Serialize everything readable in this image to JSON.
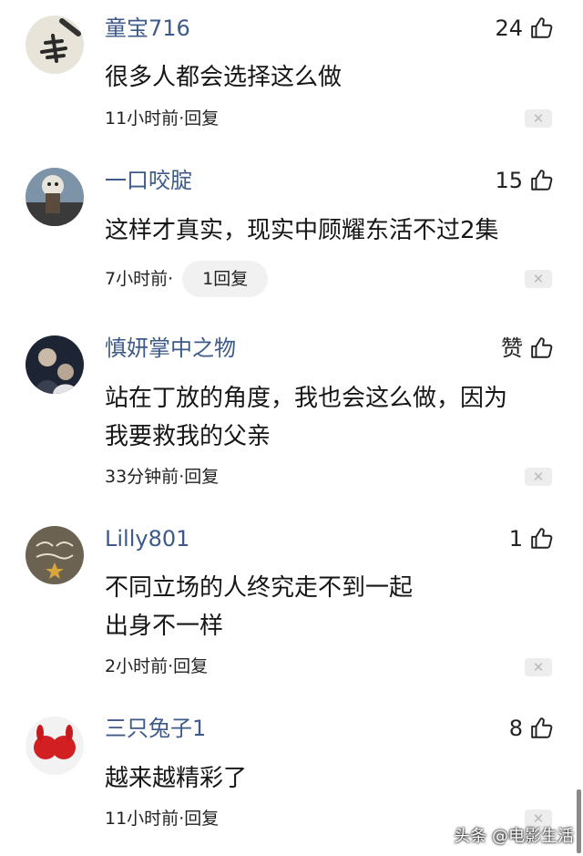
{
  "comments": [
    {
      "username": "童宝716",
      "likes": "24",
      "text_lines": [
        "很多人都会选择这么做"
      ],
      "time": "11小时前",
      "reply_label": "回复"
    },
    {
      "username": "一口咬腚",
      "likes": "15",
      "text_lines": [
        "这样才真实，现实中顾耀东活不过2集"
      ],
      "time": "7小时前",
      "reply_label": "1回复"
    },
    {
      "username": "慎妍掌中之物",
      "likes": "赞",
      "text_lines": [
        "站在丁放的角度，我也会这么做，因为",
        "我要救我的父亲"
      ],
      "time": "33分钟前",
      "reply_label": "回复"
    },
    {
      "username": "Lilly801",
      "likes": "1",
      "text_lines": [
        "不同立场的人终究走不到一起",
        "出身不一样"
      ],
      "time": "2小时前",
      "reply_label": "回复"
    },
    {
      "username": "三只兔子1",
      "likes": "8",
      "text_lines": [
        "越来越精彩了"
      ],
      "time": "11小时前",
      "reply_label": "回复"
    }
  ],
  "meta_separator": " · ",
  "close_glyph": "✕",
  "watermark": "头条 @电影生活",
  "avatar_icons": [
    "calligraphy-avatar-icon",
    "toy-figure-avatar-icon",
    "portrait-avatar-icon",
    "happy-new-year-avatar-icon",
    "red-rabbit-avatar-icon"
  ],
  "colors": {
    "username": "#3d5a88",
    "text": "#161616",
    "meta": "#222222",
    "pill_bg": "#f1f1f1"
  }
}
